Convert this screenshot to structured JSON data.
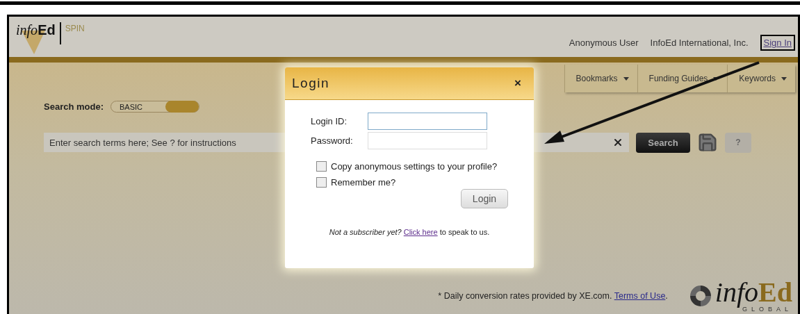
{
  "header": {
    "logo": {
      "parts": [
        "info",
        "Ed"
      ],
      "product": "SPIN"
    },
    "user_links": [
      "Anonymous User",
      "InfoEd International, Inc."
    ],
    "sign_in": "Sign In"
  },
  "nav": [
    "Bookmarks",
    "Funding Guides",
    "Keywords"
  ],
  "search_mode": {
    "label": "Search mode:",
    "value": "BASIC"
  },
  "search": {
    "placeholder": "Enter search terms here; See ? for instructions",
    "button": "Search",
    "help": "?"
  },
  "dialog": {
    "title": "Login",
    "close": "×",
    "fields": [
      {
        "label": "Login ID:",
        "focused": true
      },
      {
        "label": "Password:",
        "focused": false
      }
    ],
    "checkboxes": [
      {
        "label": "Copy anonymous settings to your profile?",
        "checked": false
      },
      {
        "label": "Remember me?",
        "checked": false
      }
    ],
    "button": "Login",
    "note": {
      "question": "Not a subscriber yet?",
      "link": "Click here",
      "rest": "to speak to us."
    }
  },
  "footer": {
    "note": "* Daily conversion rates provided by XE.com.",
    "link": "Terms of Use",
    "end": ".",
    "logo": {
      "parts": [
        "info",
        "Ed"
      ],
      "tagline": "GLOBAL"
    }
  }
}
